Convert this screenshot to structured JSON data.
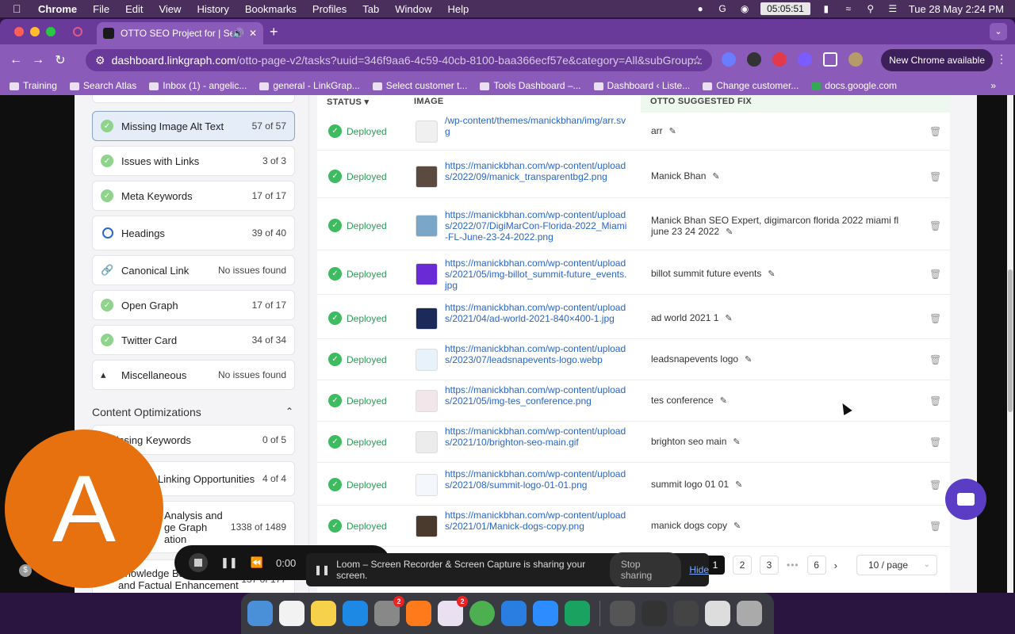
{
  "menubar": {
    "app": "Chrome",
    "items": [
      "File",
      "Edit",
      "View",
      "History",
      "Bookmarks",
      "Profiles",
      "Tab",
      "Window",
      "Help"
    ],
    "timer": "05:05:51",
    "datetime": "Tue 28 May  2:24 PM"
  },
  "browser": {
    "tab_title": "OTTO SEO Project for | Se",
    "url_host": "dashboard.linkgraph.com",
    "url_path": "/otto-page-v2/tasks?uuid=346f9aa6-4c59-40cb-8100-baa366ecf57e&category=All&subGroup...",
    "new_chrome": "New Chrome available",
    "bookmarks": [
      "Training",
      "Search Atlas",
      "Inbox (1) - angelic...",
      "general - LinkGrap...",
      "Select customer t...",
      "Tools Dashboard –...",
      "Dashboard ‹ Liste...",
      "Change customer...",
      "docs.google.com"
    ]
  },
  "sidebar": {
    "items": [
      {
        "label": "Missing Image Alt Text",
        "count": "57 of 57"
      },
      {
        "label": "Issues with Links",
        "count": "3 of 3"
      },
      {
        "label": "Meta Keywords",
        "count": "17 of 17"
      },
      {
        "label": "Headings",
        "count": "39 of 40"
      },
      {
        "label": "Canonical Link",
        "count": "No issues found"
      },
      {
        "label": "Open Graph",
        "count": "17 of 17"
      },
      {
        "label": "Twitter Card",
        "count": "34 of 34"
      },
      {
        "label": "Miscellaneous",
        "count": "No issues found"
      }
    ],
    "section_title": "Content Optimizations",
    "content_items": [
      {
        "label": "issing Keywords",
        "count": "0 of 5"
      },
      {
        "label": "Linking Opportunities",
        "count": "4 of 4"
      },
      {
        "label": "Analysis and\nge Graph\nation",
        "count": "1338 of 1489"
      },
      {
        "label": "Knowledge Ba\nand Factual Enhancement",
        "count": "137 of 177"
      }
    ]
  },
  "table": {
    "headers": {
      "status": "STATUS",
      "image": "IMAGE",
      "fix": "OTTO SUGGESTED FIX"
    },
    "rows": [
      {
        "status": "Deployed",
        "url": "/wp-content/themes/manickbhan/img/arr.svg",
        "fix": "arr",
        "thumb": "#f0f0f0"
      },
      {
        "status": "Deployed",
        "url": "https://manickbhan.com/wp-content/uploads/2022/09/manick_transparentbg2.png",
        "fix": "Manick Bhan",
        "thumb": "#5a4a40"
      },
      {
        "status": "Deployed",
        "url": "https://manickbhan.com/wp-content/uploads/2022/07/DigiMarCon-Florida-2022_Miami-FL-June-23-24-2022.png",
        "fix": "Manick Bhan SEO Expert, digimarcon florida 2022 miami fl june 23 24 2022",
        "thumb": "#7aa6c8"
      },
      {
        "status": "Deployed",
        "url": "https://manickbhan.com/wp-content/uploads/2021/05/img-billot_summit-future_events.jpg",
        "fix": "billot summit future events",
        "thumb": "#6a2bd6"
      },
      {
        "status": "Deployed",
        "url": "https://manickbhan.com/wp-content/uploads/2021/04/ad-world-2021-840×400-1.jpg",
        "fix": "ad world 2021 1",
        "thumb": "#1c2a5a"
      },
      {
        "status": "Deployed",
        "url": "https://manickbhan.com/wp-content/uploads/2023/07/leadsnapevents-logo.webp",
        "fix": "leadsnapevents logo",
        "thumb": "#e8f2fa"
      },
      {
        "status": "Deployed",
        "url": "https://manickbhan.com/wp-content/uploads/2021/05/img-tes_conference.png",
        "fix": "tes conference",
        "thumb": "#f3e6ea"
      },
      {
        "status": "Deployed",
        "url": "https://manickbhan.com/wp-content/uploads/2021/10/brighton-seo-main.gif",
        "fix": "brighton seo main",
        "thumb": "#ececec"
      },
      {
        "status": "Deployed",
        "url": "https://manickbhan.com/wp-content/uploads/2021/08/summit-logo-01-01.png",
        "fix": "summit logo 01 01",
        "thumb": "#f4f7fb"
      },
      {
        "status": "Deployed",
        "url": "https://manickbhan.com/wp-content/uploads/2021/01/Manick-dogs-copy.png",
        "fix": "manick dogs copy",
        "thumb": "#4a3a2e"
      }
    ]
  },
  "pagination": {
    "pages": [
      "1",
      "2",
      "3",
      "6"
    ],
    "page_size": "10 / page"
  },
  "loom": {
    "time": "0:00",
    "message": "Loom – Screen Recorder & Screen Capture is sharing your screen.",
    "stop_label": "Stop sharing",
    "hide_label": "Hide",
    "avatar_letter": "A"
  }
}
